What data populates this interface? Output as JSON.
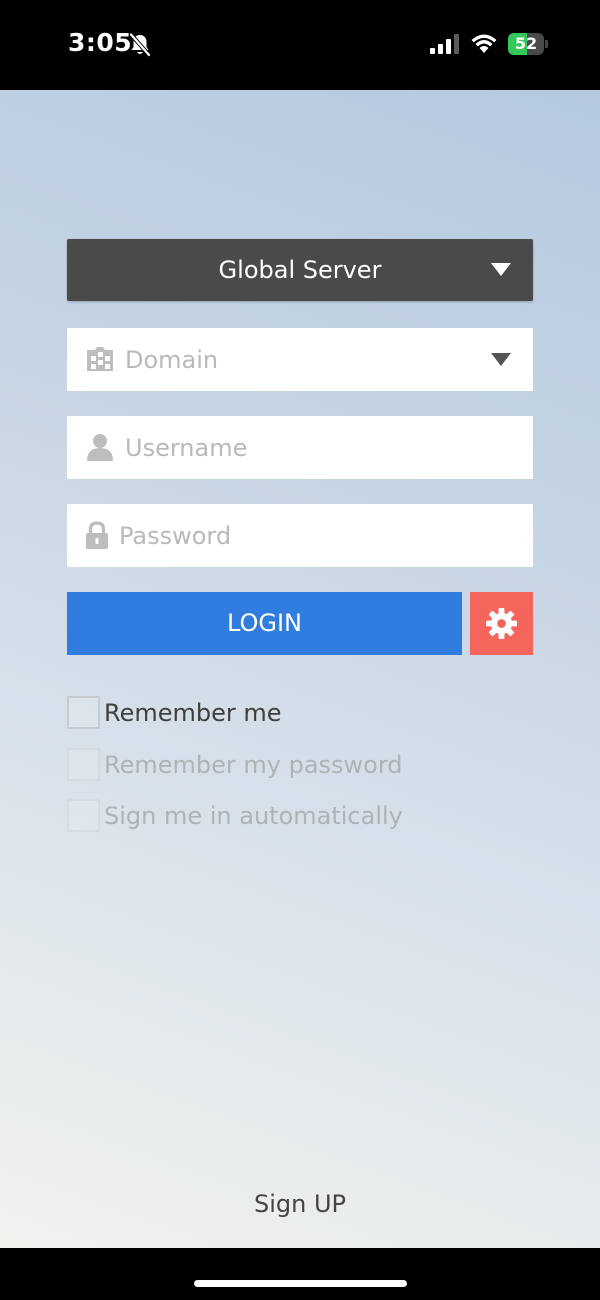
{
  "status_bar": {
    "time": "3:05",
    "battery_percent": "52",
    "battery_level": 0.52,
    "battery_color": "#34c759"
  },
  "server": {
    "label": "Global Server"
  },
  "fields": {
    "domain_placeholder": "Domain",
    "username_placeholder": "Username",
    "password_placeholder": "Password"
  },
  "buttons": {
    "login_label": "LOGIN",
    "settings_icon": "gear-icon"
  },
  "options": {
    "remember_me": "Remember me",
    "remember_password": "Remember my password",
    "sign_in_automatically": "Sign me in automatically"
  },
  "footer": {
    "signup_label": "Sign UP"
  },
  "colors": {
    "server_select": "#4a4a4a",
    "login_button": "#317ddf",
    "settings_button": "#f5655c"
  },
  "icons": {
    "status": [
      "bell-slash-icon",
      "signal-icon",
      "wifi-icon",
      "battery-icon"
    ],
    "fields": [
      "domain-building-icon",
      "user-icon",
      "lock-icon",
      "chevron-down-icon"
    ]
  }
}
